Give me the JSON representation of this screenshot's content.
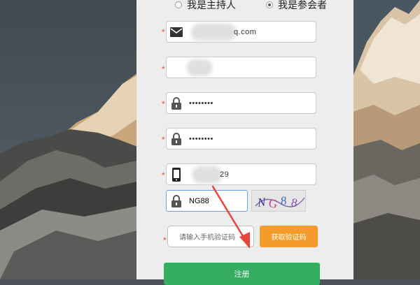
{
  "roles": {
    "host_label": "我是主持人",
    "participant_label": "我是参会者",
    "selected": "participant"
  },
  "form": {
    "required_mark": "*",
    "email": {
      "value_suffix": "q.com",
      "icon": "envelope-icon"
    },
    "username": {
      "value": ""
    },
    "password": {
      "value": "••••••••",
      "icon": "lock-icon"
    },
    "confirm_password": {
      "value": "••••••••",
      "icon": "lock-icon"
    },
    "phone": {
      "value_suffix": "29",
      "icon": "mobile-phone-icon"
    },
    "captcha": {
      "value": "NG88",
      "icon": "lock-icon",
      "image_text": "NG88"
    },
    "sms_code": {
      "placeholder": "请输入手机验证码"
    },
    "get_code_button": "获取验证码",
    "submit_button": "注册"
  },
  "colors": {
    "required": "#e8483b",
    "orange_button": "#f39c2b",
    "green_button": "#35ae62",
    "arrow": "#e8463c"
  }
}
